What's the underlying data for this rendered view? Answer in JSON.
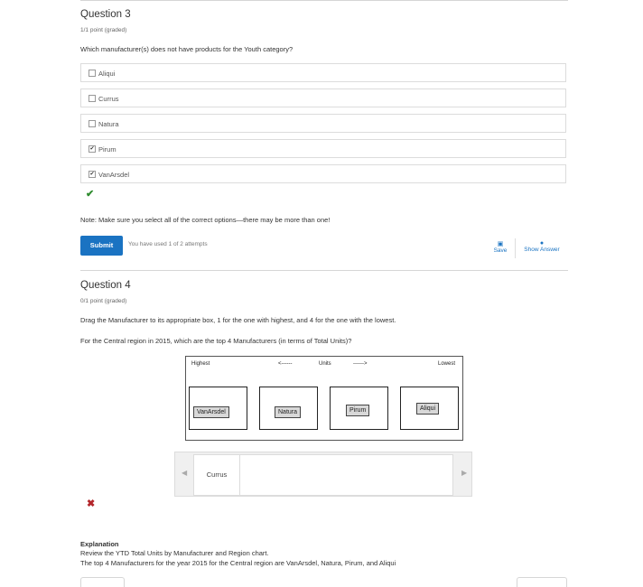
{
  "q3": {
    "title": "Question 3",
    "points": "1/1 point (graded)",
    "prompt": "Which manufacturer(s) does not have products for the Youth category?",
    "options": [
      {
        "label": "Aliqui",
        "checked": false
      },
      {
        "label": "Currus",
        "checked": false
      },
      {
        "label": "Natura",
        "checked": false
      },
      {
        "label": "Pirum",
        "checked": true
      },
      {
        "label": "VanArsdel",
        "checked": true
      }
    ],
    "result_icon": "check-icon",
    "note": "Note: Make sure you select all of the correct options—there may be more than one!",
    "submit_label": "Submit",
    "attempts": "You have used 1 of 2 attempts",
    "save_label": "Save",
    "show_answer_label": "Show Answer"
  },
  "q4": {
    "title": "Question 4",
    "points": "0/1 point (graded)",
    "prompt1": "Drag the Manufacturer to its appropriate box, 1 for the one with highest, and 4 for the one with the lowest.",
    "prompt2": "For the Central region in 2015, which are the top 4 Manufacturers (in terms of Total Units)?",
    "drop_header": {
      "highest": "Highest",
      "left_arrow": "<------",
      "units": "Units",
      "right_arrow": "------>",
      "lowest": "Lowest"
    },
    "placed": [
      "VanArsdel",
      "Natura",
      "Pirum",
      "Aliqui"
    ],
    "tray_items": [
      "Currus"
    ],
    "result_icon": "cross-icon",
    "explanation_title": "Explanation",
    "explanation_line1": "Review the YTD Total Units by Manufacturer and Region chart.",
    "explanation_line2": "The top 4 Manufacturers for the year 2015 for the Central region are VanArsdel, Natura, Pirum, and Aliqui"
  },
  "colors": {
    "accent": "#1a73c2",
    "success": "#2e8b2e",
    "error": "#b3262b"
  }
}
